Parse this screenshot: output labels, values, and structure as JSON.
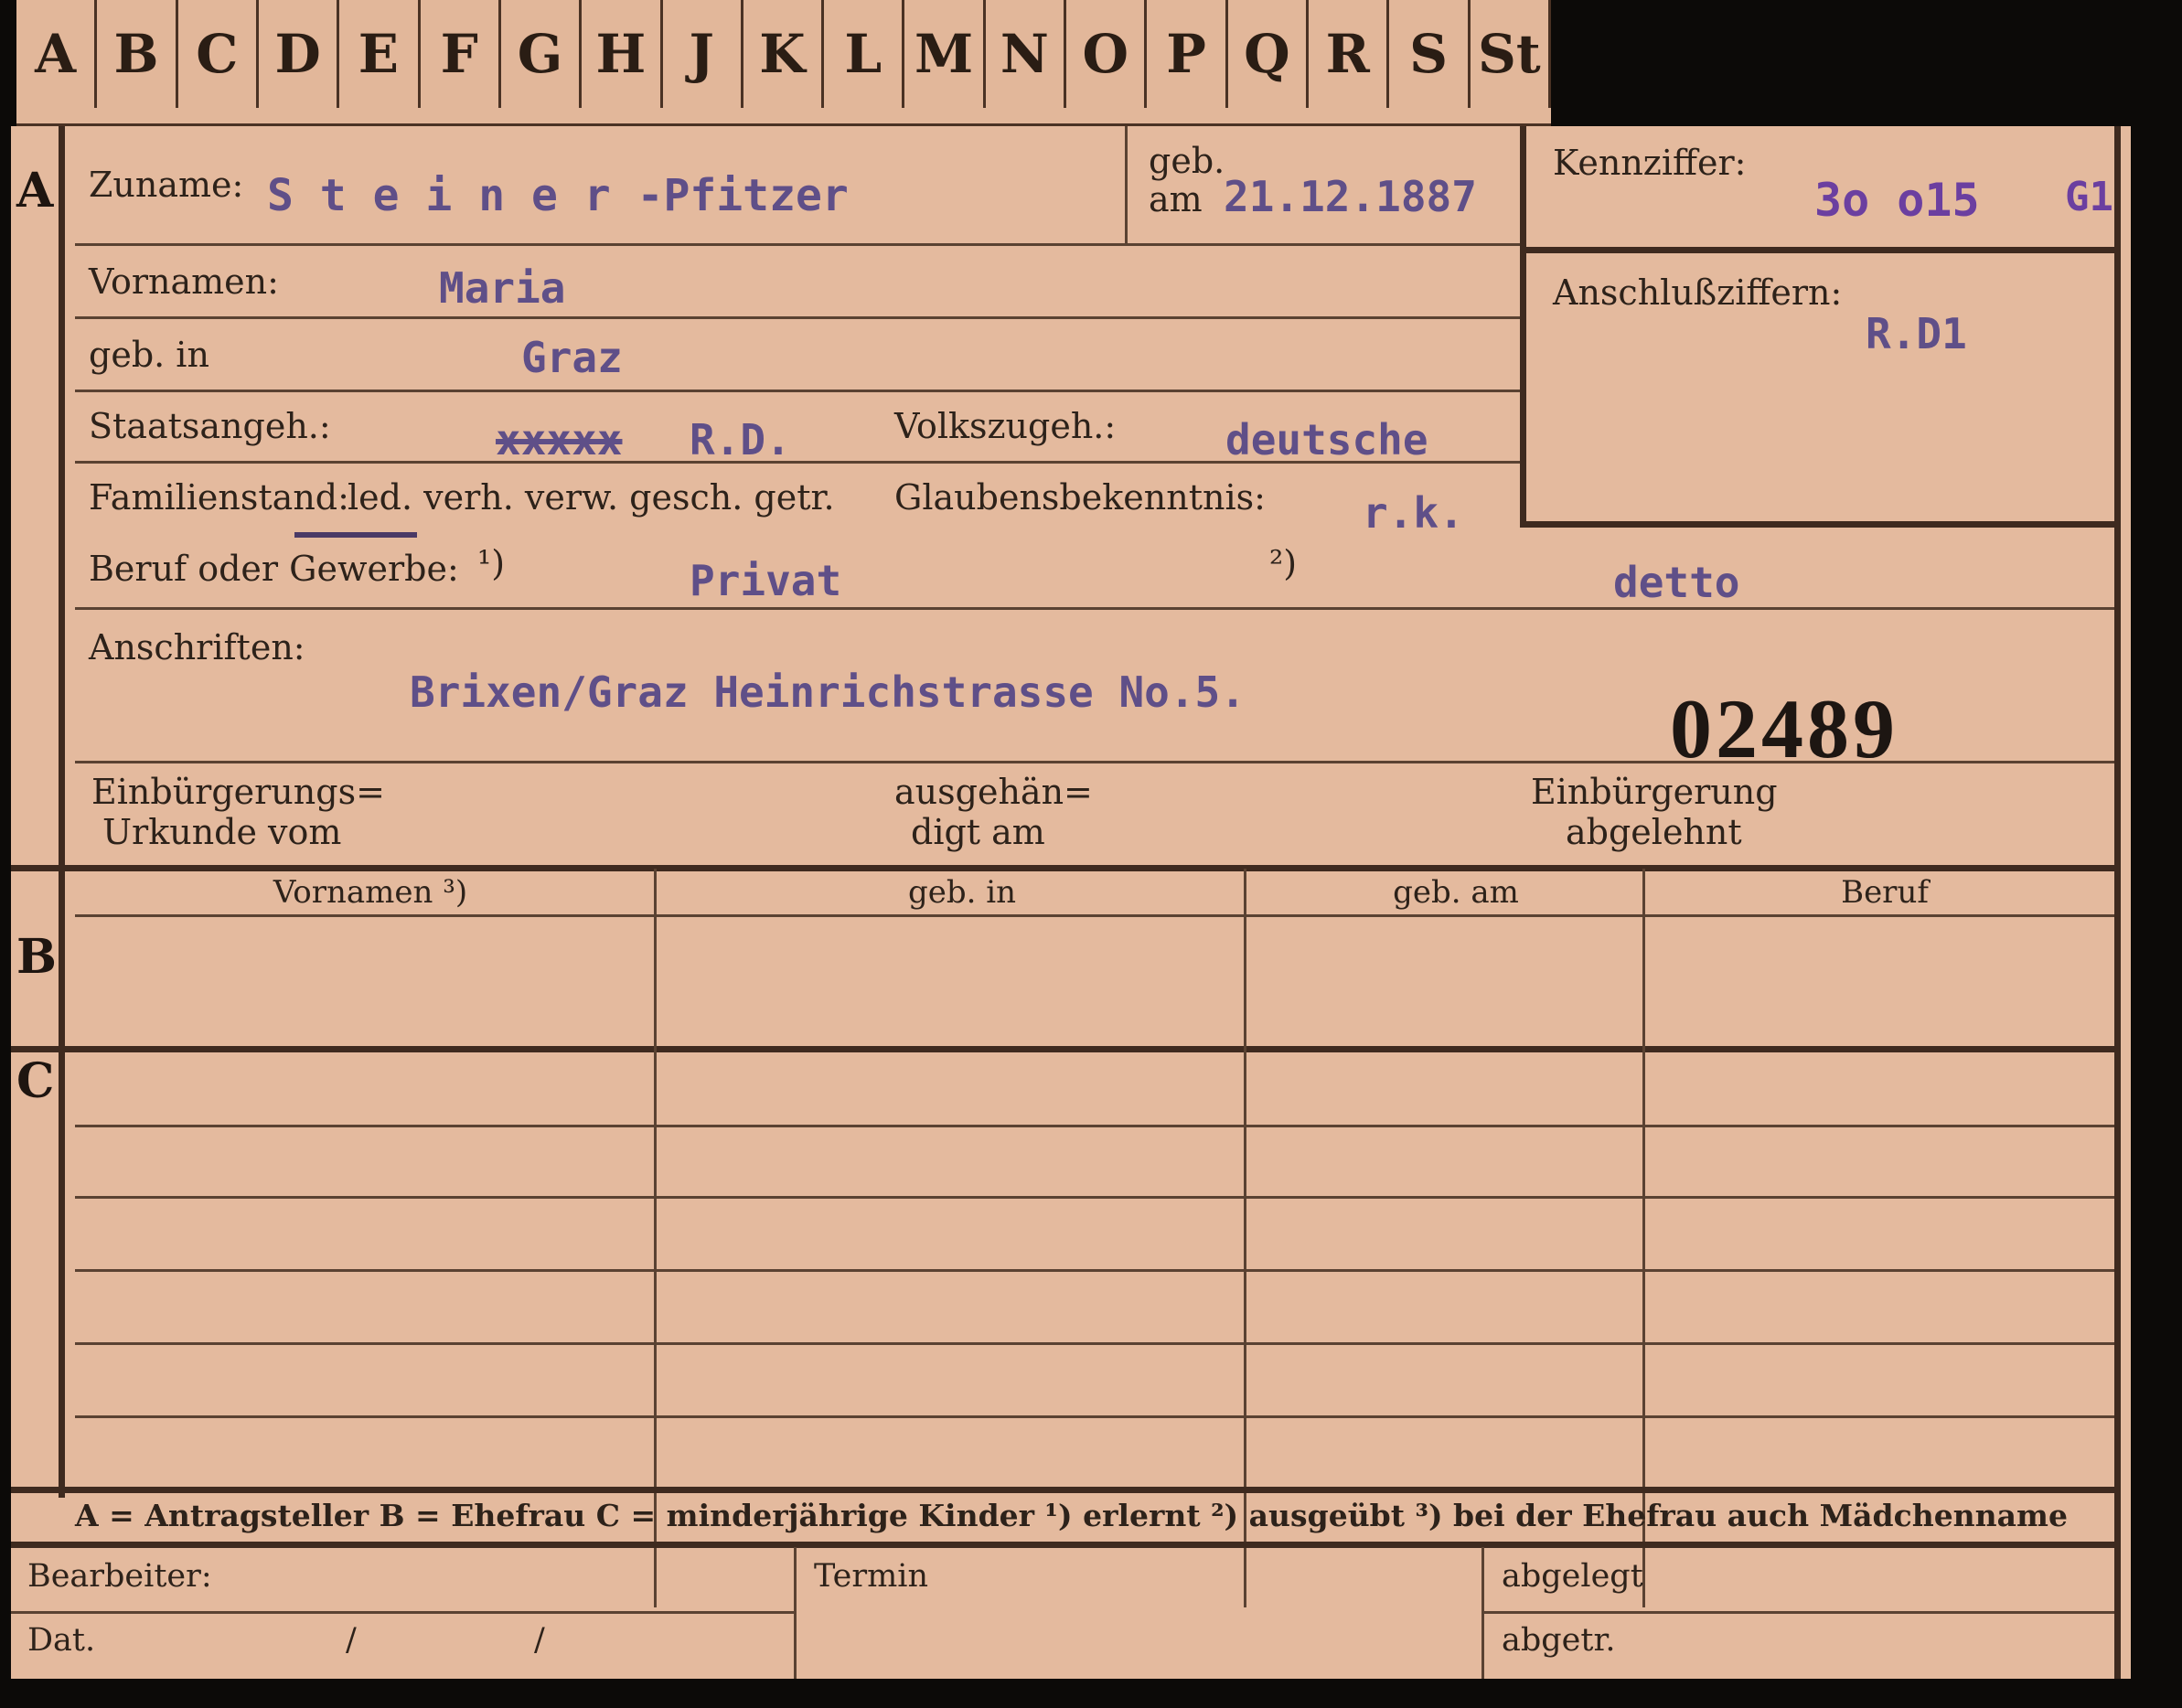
{
  "tabs": [
    "A",
    "B",
    "C",
    "D",
    "E",
    "F",
    "G",
    "H",
    "J",
    "K",
    "L",
    "M",
    "N",
    "O",
    "P",
    "Q",
    "R",
    "S",
    "St"
  ],
  "sections": {
    "a": "A",
    "b": "B",
    "c": "C"
  },
  "labels": {
    "zuname": "Zuname:",
    "geb_am_1": "geb.",
    "geb_am_2": "am",
    "kennziffer": "Kennziffer:",
    "anschlussziffern": "Anschlußziffern:",
    "vornamen": "Vornamen:",
    "geb_in": "geb. in",
    "staatsangeh": "Staatsangeh.:",
    "volkszugeh": "Volkszugeh.:",
    "familienstand": "Familienstand:",
    "familienstand_opts": "led. verh. verw. gesch. getr.",
    "glaubensbekenntnis": "Glaubensbekenntnis:",
    "beruf": "Beruf oder Gewerbe:",
    "beruf_note1": "¹)",
    "beruf_note2": "²)",
    "anschriften": "Anschriften:",
    "einbuerg_1": "Einbürgerungs=",
    "einbuerg_2": "Urkunde vom",
    "ausgeh_1": "ausgehän=",
    "ausgeh_2": "digt am",
    "abgelehnt_1": "Einbürgerung",
    "abgelehnt_2": "abgelehnt"
  },
  "values": {
    "zuname": "S t e i n e r -Pfitzer",
    "geb_am": "21.12.1887",
    "kennziffer": "3o o15",
    "kennziffer_suffix": "G1",
    "anschlussziffern": "R.D1",
    "vornamen": "Maria",
    "geb_in": "Graz",
    "staatsangeh_struck": "xxxxx",
    "staatsangeh": "R.D.",
    "volkszugeh": "deutsche",
    "glaubensbekenntnis": "r.k.",
    "beruf_erlernt": "Privat",
    "beruf_ausgeuebt": "detto",
    "anschrift": "Brixen/Graz Heinrichstrasse No.5.",
    "stamp_number": "02489"
  },
  "table_headers": [
    "Vornamen ³)",
    "geb. in",
    "geb. am",
    "Beruf"
  ],
  "footer": {
    "legend": "A = Antragsteller   B = Ehefrau   C = minderjährige Kinder   ¹) erlernt   ²) ausgeübt   ³) bei der Ehefrau auch Mädchenname",
    "bearbeiter": "Bearbeiter:",
    "dat": "Dat.",
    "slash1": "/",
    "slash2": "/",
    "termin": "Termin",
    "abgelegt": "abgelegt",
    "abgetr": "abgetr."
  },
  "colors": {
    "card": "#e4ba9e",
    "ink_stamp": "#5f4f88",
    "kennziffer_ink": "#6b3fa0",
    "rule": "#5a4232"
  }
}
